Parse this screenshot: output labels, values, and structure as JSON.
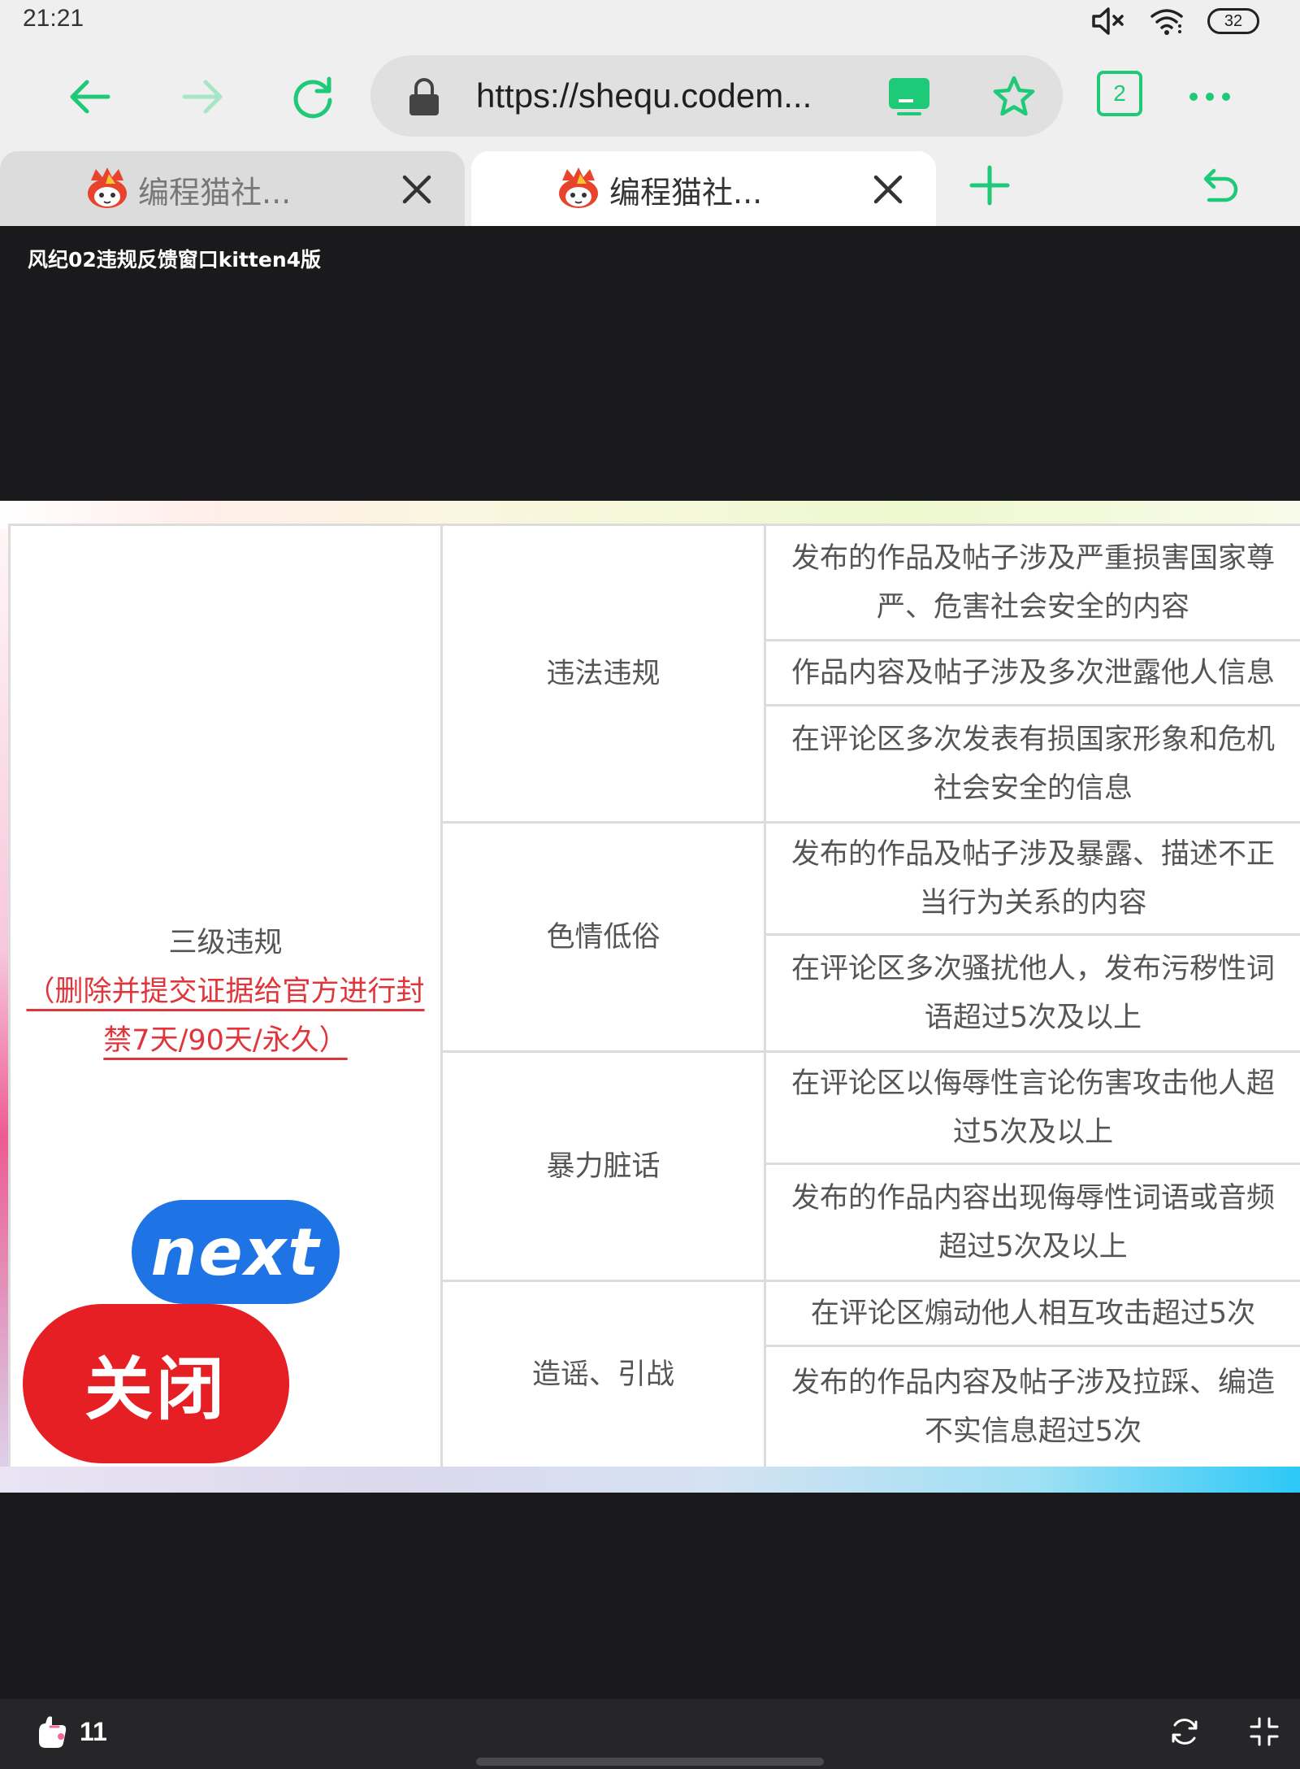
{
  "status_bar": {
    "time": "21:21",
    "battery": "32"
  },
  "toolbar": {
    "url": "https://shequ.codem...",
    "tab_count": "2"
  },
  "tabs": [
    {
      "title": "编程猫社..."
    },
    {
      "title": "编程猫社..."
    }
  ],
  "page": {
    "project_title": "风纪02违规反馈窗口kitten4版"
  },
  "table": {
    "level_name": "三级违规",
    "level_note": "（删除并提交证据给官方进行封禁7天/90天/永久）",
    "categories": [
      "违法违规",
      "色情低俗",
      "暴力脏话",
      "造谣、引战"
    ],
    "rules": [
      "发布的作品及帖子涉及严重损害国家尊严、危害社会安全的内容",
      "作品内容及帖子涉及多次泄露他人信息",
      "在评论区多次发表有损国家形象和危机社会安全的信息",
      "发布的作品及帖子涉及暴露、描述不正当行为关系的内容",
      "在评论区多次骚扰他人，发布污秽性词语超过5次及以上",
      "在评论区以侮辱性言论伤害攻击他人超过5次及以上",
      "发布的作品内容出现侮辱性词语或音频超过5次及以上",
      "在评论区煽动他人相互攻击超过5次",
      "发布的作品内容及帖子涉及拉踩、编造不实信息超过5次"
    ]
  },
  "buttons": {
    "next": "next",
    "close": "关闭"
  },
  "bottom_bar": {
    "like_count": "11"
  },
  "colors": {
    "accent_green": "#1ec977",
    "next_blue": "#1f74e5",
    "close_red": "#e61f24",
    "note_red": "#e0353a"
  }
}
